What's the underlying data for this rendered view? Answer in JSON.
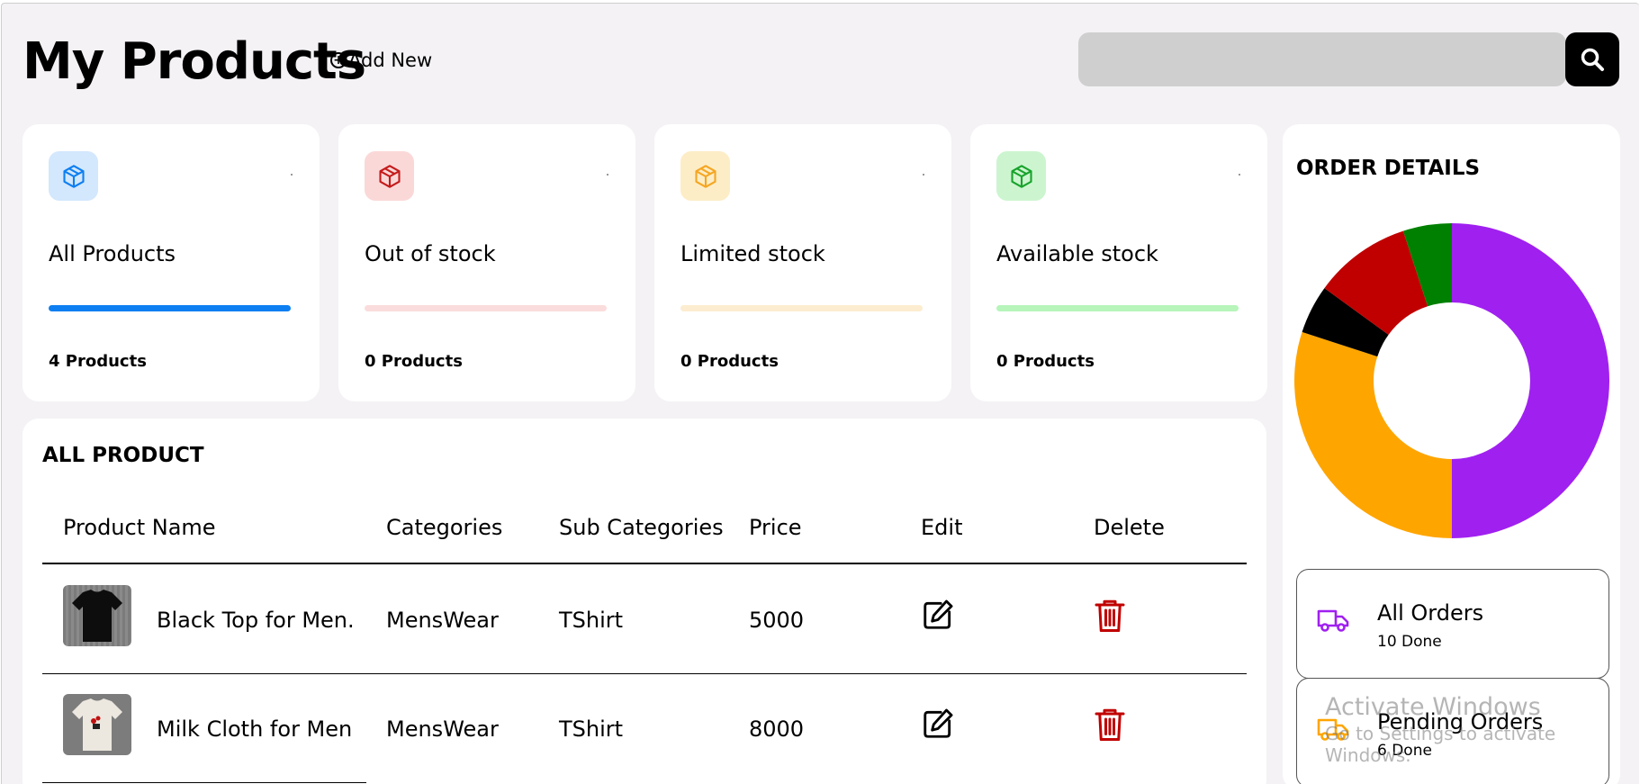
{
  "header": {
    "title": "My Products",
    "add_new_label": "Add New",
    "search_placeholder": ""
  },
  "stat_cards": [
    {
      "title": "All Products",
      "count": "4 Products",
      "accent": "#0d7ff2",
      "icon_bg": "#d3e7fd",
      "bar_color": "#0d7ff2"
    },
    {
      "title": "Out of stock",
      "count": "0 Products",
      "accent": "#c41b1b",
      "icon_bg": "#fbd8d8",
      "bar_color": "#fbdcdc"
    },
    {
      "title": "Limited stock",
      "count": "0 Products",
      "accent": "#f5a623",
      "icon_bg": "#fdedc6",
      "bar_color": "#fcedd0"
    },
    {
      "title": "Available stock",
      "count": "0 Products",
      "accent": "#18a32c",
      "icon_bg": "#ccf5cf",
      "bar_color": "#b7f5bb"
    }
  ],
  "products": {
    "heading": "ALL PRODUCT",
    "columns": [
      "Product Name",
      "Categories",
      "Sub Categories",
      "Price",
      "Edit",
      "Delete"
    ],
    "rows": [
      {
        "name": "Black Top for Men.",
        "category": "MensWear",
        "sub_category": "TShirt",
        "price": "5000",
        "thumb": "black-tshirt"
      },
      {
        "name": "Milk Cloth for Men",
        "category": "MensWear",
        "sub_category": "TShirt",
        "price": "8000",
        "thumb": "white-tshirt"
      }
    ]
  },
  "orders": {
    "heading": "ORDER DETAILS",
    "chart_data": {
      "type": "pie",
      "variant": "donut",
      "slices": [
        {
          "value": 50,
          "color": "#a020f0"
        },
        {
          "value": 30,
          "color": "#ffa500"
        },
        {
          "value": 5,
          "color": "#000000"
        },
        {
          "value": 10,
          "color": "#c00000"
        },
        {
          "value": 5,
          "color": "#008000"
        }
      ]
    },
    "cards": [
      {
        "title": "All Orders",
        "subtitle": "10 Done",
        "icon": "truck-icon",
        "color": "#a020f0"
      },
      {
        "title": "Pending Orders",
        "subtitle": "6 Done",
        "icon": "truck-icon",
        "color": "#ffa500"
      }
    ]
  },
  "watermark": {
    "line1": "Activate Windows",
    "line2": "Go to Settings to activate Windows."
  }
}
